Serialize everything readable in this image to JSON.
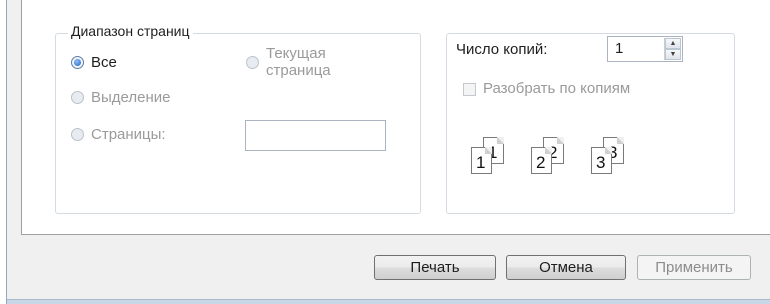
{
  "page_range": {
    "title": "Диапазон страниц",
    "options": {
      "all": "Все",
      "current_page": "Текущая страница",
      "selection": "Выделение",
      "pages": "Страницы:"
    },
    "selected": "all",
    "pages_input_value": ""
  },
  "copies": {
    "label": "Число копий:",
    "value": "1",
    "collate_label": "Разобрать по копиям",
    "collate_checked": false,
    "preview_numbers": [
      "1",
      "1",
      "2",
      "2",
      "3",
      "3"
    ]
  },
  "buttons": {
    "print": "Печать",
    "cancel": "Отмена",
    "apply": "Применить"
  },
  "icons": {
    "spin_up": "spin-up-arrow-icon",
    "spin_down": "spin-down-arrow-icon",
    "collate": "collate-pages-icon"
  }
}
